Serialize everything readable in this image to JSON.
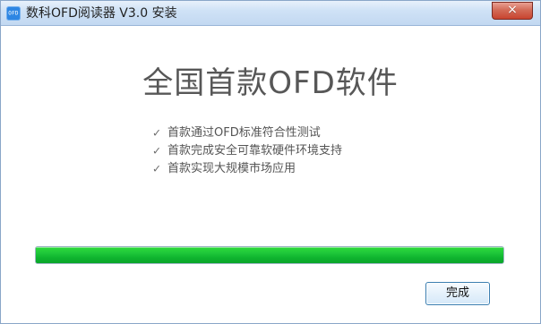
{
  "window": {
    "title": "数科OFD阅读器 V3.0 安装",
    "app_icon_text": "OFD",
    "close_glyph": "×"
  },
  "main": {
    "title": "全国首款OFD软件",
    "features": [
      "首款通过OFD标准符合性测试",
      "首款完成安全可靠软硬件环境支持",
      "首款实现大规模市场应用"
    ],
    "check_glyph": "✓"
  },
  "progress": {
    "value_percent": 100,
    "fill_color": "#19c934"
  },
  "buttons": {
    "finish_label": "完成"
  },
  "icons": {
    "app_icon": "ofd-app-icon",
    "close_icon": "close-icon",
    "check_icon": "check-icon"
  }
}
